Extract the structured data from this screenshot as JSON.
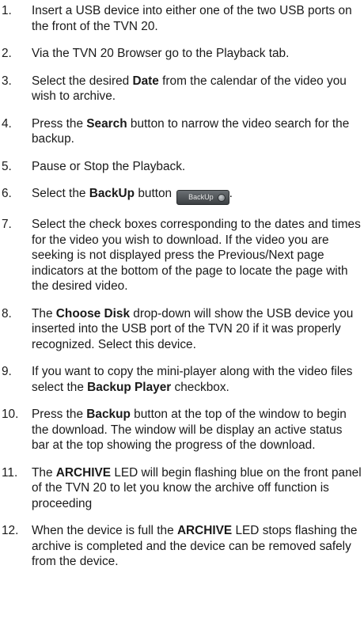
{
  "steps": [
    {
      "num": "1.",
      "parts": [
        {
          "t": "Insert a USB device into either one of the two USB ports on the front of the TVN 20.",
          "b": false
        }
      ]
    },
    {
      "num": "2.",
      "parts": [
        {
          "t": "Via the TVN 20 Browser go to the Playback tab.",
          "b": false
        }
      ]
    },
    {
      "num": "3.",
      "parts": [
        {
          "t": "Select the desired ",
          "b": false
        },
        {
          "t": "Date",
          "b": true
        },
        {
          "t": " from the calendar of the video you wish to archive.",
          "b": false
        }
      ]
    },
    {
      "num": "4.",
      "parts": [
        {
          "t": "Press the ",
          "b": false
        },
        {
          "t": "Search",
          "b": true
        },
        {
          "t": " button to narrow the video search for the backup.",
          "b": false
        }
      ]
    },
    {
      "num": "5.",
      "parts": [
        {
          "t": "Pause or Stop the Playback.",
          "b": false
        }
      ]
    },
    {
      "num": "6.",
      "parts": [
        {
          "t": "Select the ",
          "b": false
        },
        {
          "t": "BackUp",
          "b": true
        },
        {
          "t": " button",
          "b": false
        }
      ],
      "button_label": "BackUp",
      "after_button": "."
    },
    {
      "num": "7.",
      "parts": [
        {
          "t": "Select the check boxes corresponding to the dates and times for the video you wish to download.  If the video you are seeking is not displayed press the Previous/Next page indicators at the bottom of the page to locate the page with the desired video.",
          "b": false
        }
      ]
    },
    {
      "num": "8.",
      "parts": [
        {
          "t": "The ",
          "b": false
        },
        {
          "t": "Choose Disk",
          "b": true
        },
        {
          "t": " drop-down will show the USB device you inserted into the USB port of the TVN 20 if it was properly recognized.  Select this device.",
          "b": false
        }
      ]
    },
    {
      "num": "9.",
      "parts": [
        {
          "t": "If you want to copy the mini-player along with the video files select the ",
          "b": false
        },
        {
          "t": "Backup Player",
          "b": true
        },
        {
          "t": " checkbox.",
          "b": false
        }
      ]
    },
    {
      "num": "10.",
      "parts": [
        {
          "t": "Press the ",
          "b": false
        },
        {
          "t": "Backup",
          "b": true
        },
        {
          "t": " button at the top of the window to begin the download.  The window will be display an active status bar at the top showing the progress of the download.",
          "b": false
        }
      ]
    },
    {
      "num": "11.",
      "parts": [
        {
          "t": "The ",
          "b": false
        },
        {
          "t": "ARCHIVE",
          "b": true
        },
        {
          "t": " LED will begin flashing blue on the front panel of the TVN 20 to let you know the archive off function is proceeding",
          "b": false
        }
      ]
    },
    {
      "num": "12.",
      "parts": [
        {
          "t": "When the device is full the ",
          "b": false
        },
        {
          "t": "ARCHIVE",
          "b": true
        },
        {
          "t": " LED stops flashing the archive is completed and the device can be removed safely from the device.",
          "b": false
        }
      ]
    }
  ]
}
